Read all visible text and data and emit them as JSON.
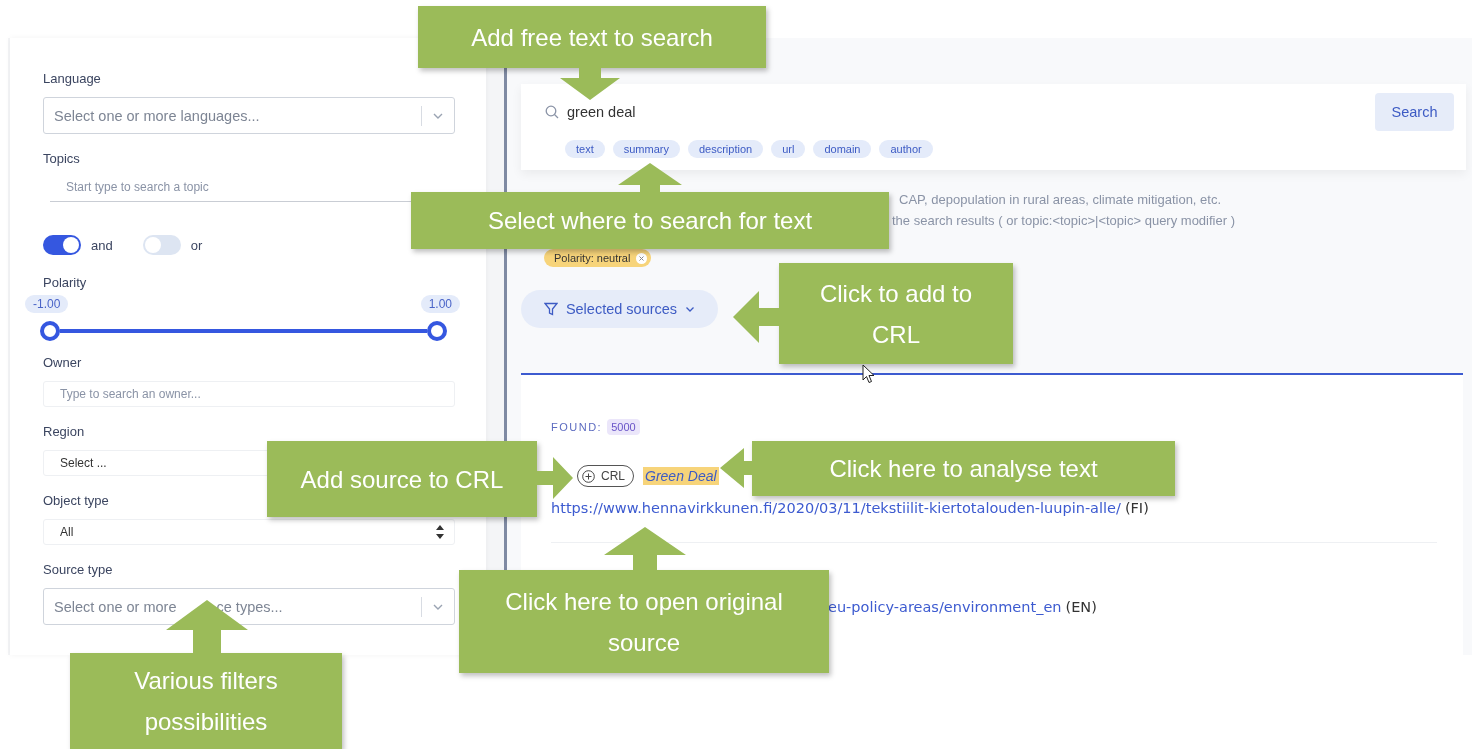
{
  "filters": [
    {
      "kind": "multiselect",
      "label": "Language",
      "placeholder": "Select one or more languages..."
    },
    {
      "kind": "underline",
      "label": "Topics",
      "placeholder": "Start type to search a topic"
    },
    {
      "kind": "toggles",
      "toggles": [
        {
          "label": "and",
          "on": true
        },
        {
          "label": "or",
          "on": false
        }
      ]
    },
    {
      "kind": "range",
      "label": "Polarity",
      "thumbs": [
        {
          "value": "-1.00"
        },
        {
          "value": "1.00"
        }
      ]
    },
    {
      "kind": "input",
      "label": "Owner",
      "placeholder": "Type to search an owner..."
    },
    {
      "kind": "select",
      "label": "Region",
      "value": "Select ..."
    },
    {
      "kind": "stepper",
      "label": "Object type",
      "value": "All"
    },
    {
      "kind": "multiselect",
      "label": "Source type",
      "placeholder_parts": [
        "Select one or more",
        "ce types..."
      ]
    }
  ],
  "search": {
    "value": "green deal",
    "button": "Search",
    "scopes": [
      "text",
      "summary",
      "description",
      "url",
      "domain",
      "author"
    ]
  },
  "hints": [
    "CAP, depopulation in rural areas, climate mitigation, etc.",
    "the search results ( or topic:<topic>|<topic> query modifier )"
  ],
  "active_filters": [
    {
      "label": "Polarity: neutral"
    }
  ],
  "sources_button": "Selected sources",
  "found": {
    "label": "FOUND:",
    "count": "5000"
  },
  "results": [
    {
      "crl": "CRL",
      "title": "Green Deal",
      "url": "https://www.hennavirkkunen.fi/2020/03/11/tekstiilit-kiertotalouden-luupin-alle/",
      "lang": "(FI)"
    },
    {
      "url": "eu-policy-areas/environment_en",
      "lang": "(EN)"
    }
  ],
  "callouts": [
    {
      "text": "Add free text to search",
      "kind": "down"
    },
    {
      "text": "Select where to search for text",
      "kind": "up"
    },
    {
      "text": "Click to add to CRL",
      "kind": "left"
    },
    {
      "text": "Add source to CRL",
      "kind": "right"
    },
    {
      "text": "Click here to analyse text",
      "kind": "left"
    },
    {
      "text": "Click here to open original source",
      "kind": "up"
    },
    {
      "text": "Various filters possibilities",
      "kind": "up"
    }
  ]
}
